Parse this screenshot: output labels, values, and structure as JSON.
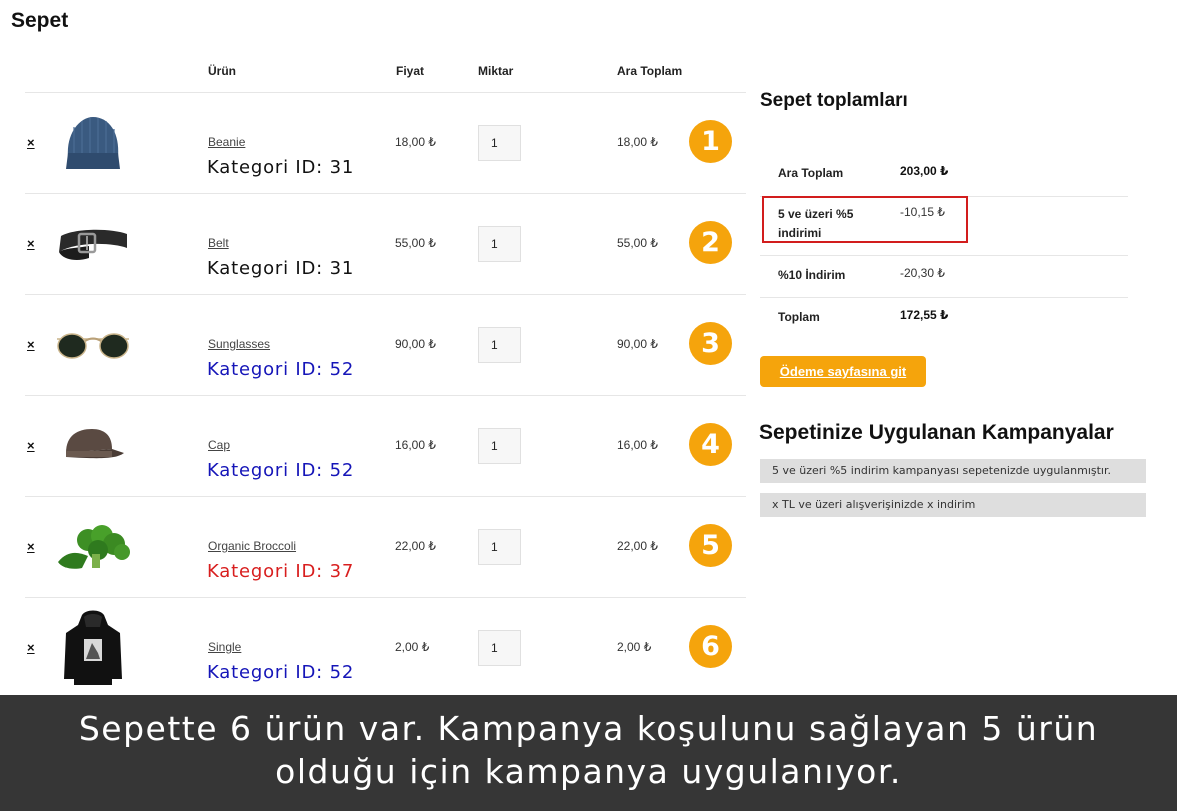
{
  "page": {
    "title": "Sepet"
  },
  "cart": {
    "headers": {
      "product": "Ürün",
      "price": "Fiyat",
      "quantity": "Miktar",
      "subtotal": "Ara Toplam"
    },
    "remove_symbol": "×",
    "items": [
      {
        "name": "Beanie",
        "category": "Kategori ID: 31",
        "category_color": "#111111",
        "price": "18,00 ₺",
        "qty": "1",
        "subtotal": "18,00 ₺",
        "badge": "1"
      },
      {
        "name": "Belt",
        "category": "Kategori ID: 31",
        "category_color": "#111111",
        "price": "55,00 ₺",
        "qty": "1",
        "subtotal": "55,00 ₺",
        "badge": "2"
      },
      {
        "name": "Sunglasses",
        "category": "Kategori ID: 52",
        "category_color": "#1515b8",
        "price": "90,00 ₺",
        "qty": "1",
        "subtotal": "90,00 ₺",
        "badge": "3"
      },
      {
        "name": "Cap",
        "category": "Kategori ID: 52",
        "category_color": "#1515b8",
        "price": "16,00 ₺",
        "qty": "1",
        "subtotal": "16,00 ₺",
        "badge": "4"
      },
      {
        "name": "Organic Broccoli",
        "category": "Kategori ID: 37",
        "category_color": "#d81e1e",
        "price": "22,00 ₺",
        "qty": "1",
        "subtotal": "22,00 ₺",
        "badge": "5"
      },
      {
        "name": "Single",
        "category": "Kategori ID: 52",
        "category_color": "#1515b8",
        "price": "2,00 ₺",
        "qty": "1",
        "subtotal": "2,00 ₺",
        "badge": "6"
      }
    ]
  },
  "totals": {
    "title": "Sepet toplamları",
    "subtotal_label": "Ara Toplam",
    "subtotal_value": "203,00 ₺",
    "discount1_label": "5 ve üzeri %5 indirimi",
    "discount1_value": "-10,15 ₺",
    "discount2_label": "%10 İndirim",
    "discount2_value": "-20,30 ₺",
    "total_label": "Toplam",
    "total_value": "172,55 ₺",
    "checkout_label": "Ödeme sayfasına git"
  },
  "campaigns": {
    "title": "Sepetinize Uygulanan Kampanyalar",
    "items": [
      "5 ve üzeri %5 indirim kampanyası sepetenizde uygulanmıştır.",
      "x TL ve üzeri alışverişinizde x indirim"
    ]
  },
  "caption": {
    "line1": "Sepette 6 ürün var. Kampanya koşulunu sağlayan 5 ürün",
    "line2": "olduğu için kampanya uygulanıyor."
  },
  "colors": {
    "accent": "#f5a40c",
    "highlight": "#d21d1d",
    "caption_bg": "#363636"
  }
}
